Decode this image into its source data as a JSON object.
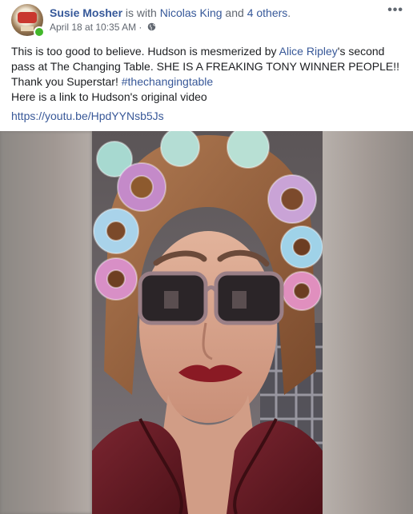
{
  "post": {
    "author": "Susie Mosher",
    "with_text": " is with ",
    "tagged_person": "Nicolas King",
    "and_text": " and ",
    "others_link": "4 others",
    "period": ".",
    "timestamp": "April 18 at 10:35 AM",
    "separator": " · ",
    "privacy_icon": "globe-icon",
    "more_label": "•••"
  },
  "body": {
    "seg1": "This is too good to believe. Hudson is mesmerized by ",
    "mention": "Alice Ripley",
    "seg2": "'s second pass at The Changing Table. SHE IS A FREAKING TONY WINNER PEOPLE!! Thank you Superstar! ",
    "hashtag": "#thechangingtable",
    "line3": "Here is a link to Hudson's original video",
    "url": "https://youtu.be/HpdYYNsb5Js"
  },
  "colors": {
    "link": "#365899",
    "online": "#42b72a",
    "text": "#1c1e21",
    "muted": "#616770"
  }
}
